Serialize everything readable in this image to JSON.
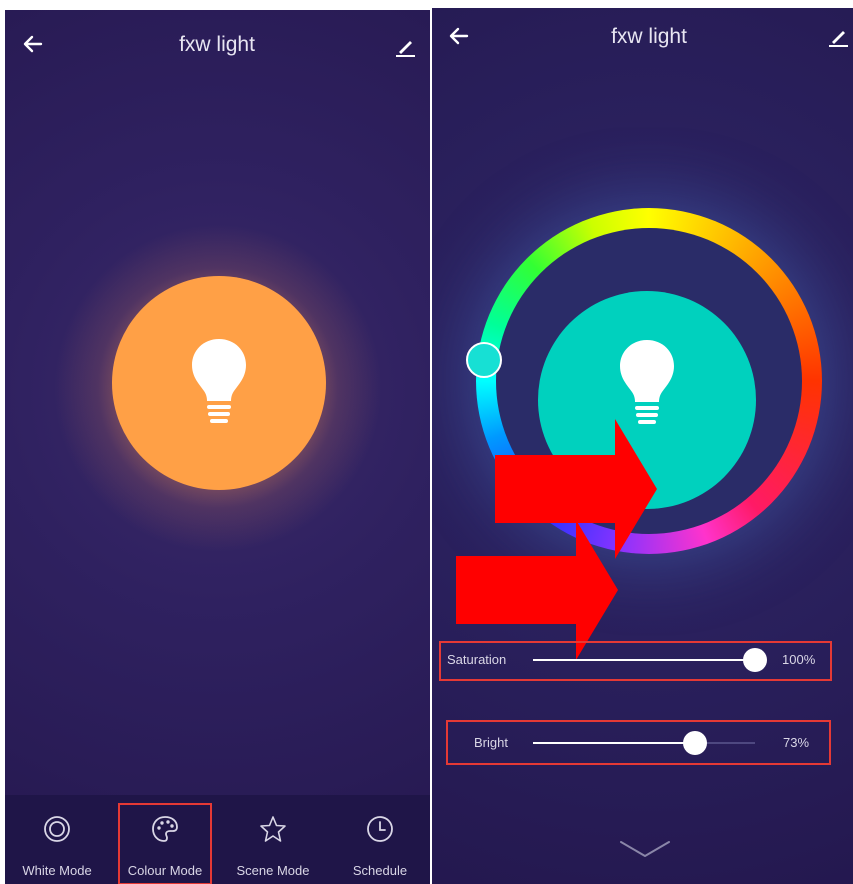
{
  "left_screen": {
    "header": {
      "back_icon": "arrow-left-icon",
      "title": "fxw light",
      "edit_icon": "pencil-icon"
    },
    "bulb": {
      "color": "#ffa046",
      "icon": "lightbulb-icon"
    },
    "bottom_nav": [
      {
        "label": "White Mode",
        "icon": "white-mode-icon"
      },
      {
        "label": "Colour Mode",
        "icon": "palette-icon",
        "highlighted": true
      },
      {
        "label": "Scene Mode",
        "icon": "star-icon"
      },
      {
        "label": "Schedule",
        "icon": "clock-icon"
      }
    ]
  },
  "right_screen": {
    "header": {
      "back_icon": "arrow-left-icon",
      "title": "fxw light",
      "edit_icon": "pencil-icon"
    },
    "bulb": {
      "color": "#00d1be",
      "icon": "lightbulb-icon"
    },
    "color_wheel": {
      "selected_color": "#17e0d4"
    },
    "saturation": {
      "label": "Saturation",
      "value": "100%",
      "fraction": 1.0
    },
    "brightness": {
      "label": "Bright",
      "value": "73%",
      "fraction": 0.73
    },
    "collapse_icon": "chevron-down-icon"
  },
  "annotation": {
    "highlight_color": "#e53935",
    "arrow_color": "#ff0000"
  }
}
